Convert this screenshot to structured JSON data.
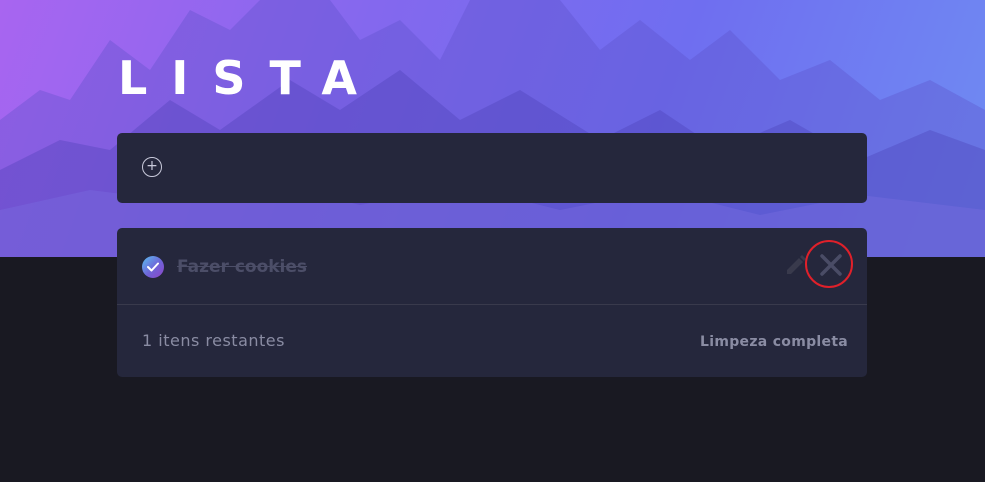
{
  "header": {
    "title": "LISTA"
  },
  "new_todo": {
    "add_icon": "plus-circle-icon",
    "value": "",
    "placeholder": ""
  },
  "todos": [
    {
      "text": "Fazer cookies",
      "completed": true,
      "check_icon": "checkmark-icon",
      "edit_icon": "pencil-icon",
      "delete_icon": "close-icon"
    }
  ],
  "footer": {
    "items_left": "1 itens restantes",
    "clear_label": "Limpeza completa"
  },
  "colors": {
    "card_bg": "#25273c",
    "page_bg": "#191922",
    "hero_gradient_start": "#a865f0",
    "hero_gradient_end": "#6f8cf3",
    "completed_text": "#4c4e68",
    "muted_text": "#8a8ca3",
    "highlight_ring": "#e0202a"
  }
}
